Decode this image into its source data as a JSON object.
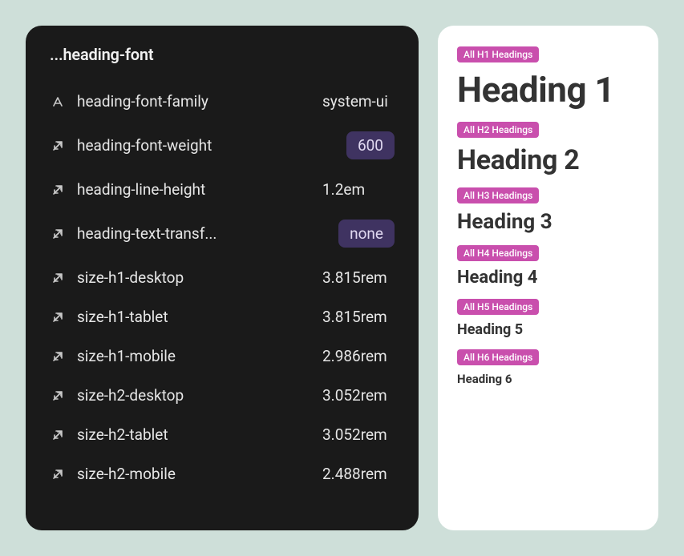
{
  "panel": {
    "title": "...heading-font",
    "props": [
      {
        "icon": "font-icon",
        "label": "heading-font-family",
        "value": "system-ui",
        "chip": false
      },
      {
        "icon": "arrow-icon",
        "label": "heading-font-weight",
        "value": "600",
        "chip": true
      },
      {
        "icon": "arrow-icon",
        "label": "heading-line-height",
        "value": "1.2em",
        "chip": false
      },
      {
        "icon": "arrow-icon",
        "label": "heading-text-transf...",
        "value": "none",
        "chip": true
      },
      {
        "icon": "arrow-icon",
        "label": "size-h1-desktop",
        "value": "3.815rem",
        "chip": false
      },
      {
        "icon": "arrow-icon",
        "label": "size-h1-tablet",
        "value": "3.815rem",
        "chip": false
      },
      {
        "icon": "arrow-icon",
        "label": "size-h1-mobile",
        "value": "2.986rem",
        "chip": false
      },
      {
        "icon": "arrow-icon",
        "label": "size-h2-desktop",
        "value": "3.052rem",
        "chip": false
      },
      {
        "icon": "arrow-icon",
        "label": "size-h2-tablet",
        "value": "3.052rem",
        "chip": false
      },
      {
        "icon": "arrow-icon",
        "label": "size-h2-mobile",
        "value": "2.488rem",
        "chip": false
      }
    ]
  },
  "preview": {
    "groups": [
      {
        "tag": "All H1 Headings",
        "text": "Heading 1",
        "cls": "h1"
      },
      {
        "tag": "All H2 Headings",
        "text": "Heading 2",
        "cls": "h2"
      },
      {
        "tag": "All H3 Headings",
        "text": "Heading 3",
        "cls": "h3"
      },
      {
        "tag": "All H4 Headings",
        "text": "Heading 4",
        "cls": "h4"
      },
      {
        "tag": "All H5 Headings",
        "text": "Heading 5",
        "cls": "h5"
      },
      {
        "tag": "All H6 Headings",
        "text": "Heading 6",
        "cls": "h6"
      }
    ]
  }
}
